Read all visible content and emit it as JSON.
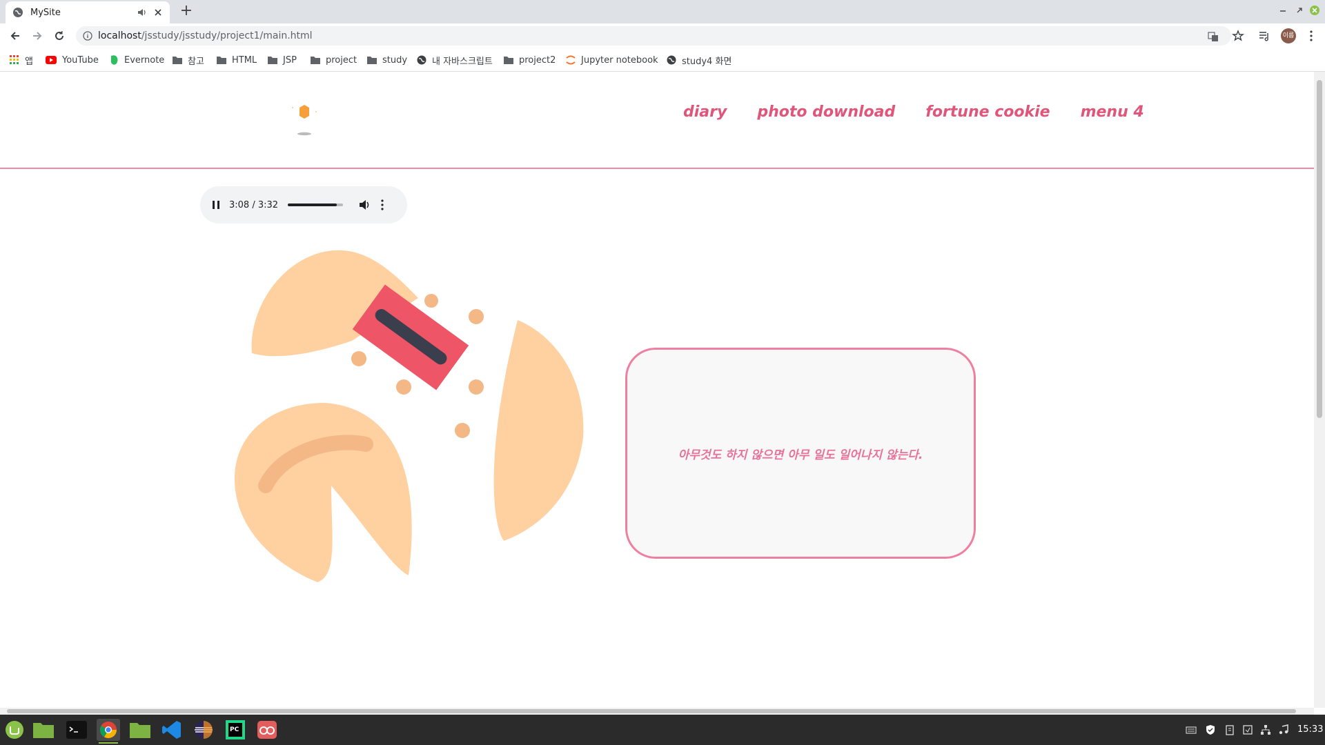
{
  "browser": {
    "tab": {
      "title": "MySite"
    },
    "url": {
      "host": "localhost",
      "path": "/jsstudy/jsstudy/project1/main.html"
    },
    "avatar_label": "이름",
    "bookmarks": [
      {
        "label": "앱",
        "icon": "apps-grid-icon"
      },
      {
        "label": "YouTube",
        "icon": "youtube-icon"
      },
      {
        "label": "Evernote",
        "icon": "evernote-icon"
      },
      {
        "label": "참고",
        "icon": "folder-icon"
      },
      {
        "label": "HTML",
        "icon": "folder-icon"
      },
      {
        "label": "JSP",
        "icon": "folder-icon"
      },
      {
        "label": "project",
        "icon": "folder-icon"
      },
      {
        "label": "study",
        "icon": "folder-icon"
      },
      {
        "label": "내 자바스크립트",
        "icon": "globe-icon"
      },
      {
        "label": "project2",
        "icon": "folder-icon"
      },
      {
        "label": "Jupyter notebook",
        "icon": "jupyter-icon"
      },
      {
        "label": "study4 화면",
        "icon": "globe-icon"
      }
    ]
  },
  "site": {
    "nav": {
      "items": [
        {
          "label": "diary"
        },
        {
          "label": "photo download"
        },
        {
          "label": "fortune cookie"
        },
        {
          "label": "menu 4"
        }
      ]
    },
    "audio": {
      "time": "3:08 / 3:32",
      "progress_fraction": 0.89
    },
    "fortune": {
      "message": "아무것도 하지 않으면 아무 일도 일어나지 않는다."
    },
    "colors": {
      "accent": "#e0557a",
      "border": "#ef7fa1",
      "cookie": "#ffd0a0",
      "paper": "#ee5566"
    }
  },
  "taskbar": {
    "clock": "15:33",
    "apps": [
      {
        "name": "mint-menu-icon"
      },
      {
        "name": "files-icon"
      },
      {
        "name": "terminal-icon"
      },
      {
        "name": "chrome-icon"
      },
      {
        "name": "files-icon"
      },
      {
        "name": "vscode-icon"
      },
      {
        "name": "eclipse-icon"
      },
      {
        "name": "pycharm-icon"
      },
      {
        "name": "glasses-app-icon"
      }
    ]
  }
}
